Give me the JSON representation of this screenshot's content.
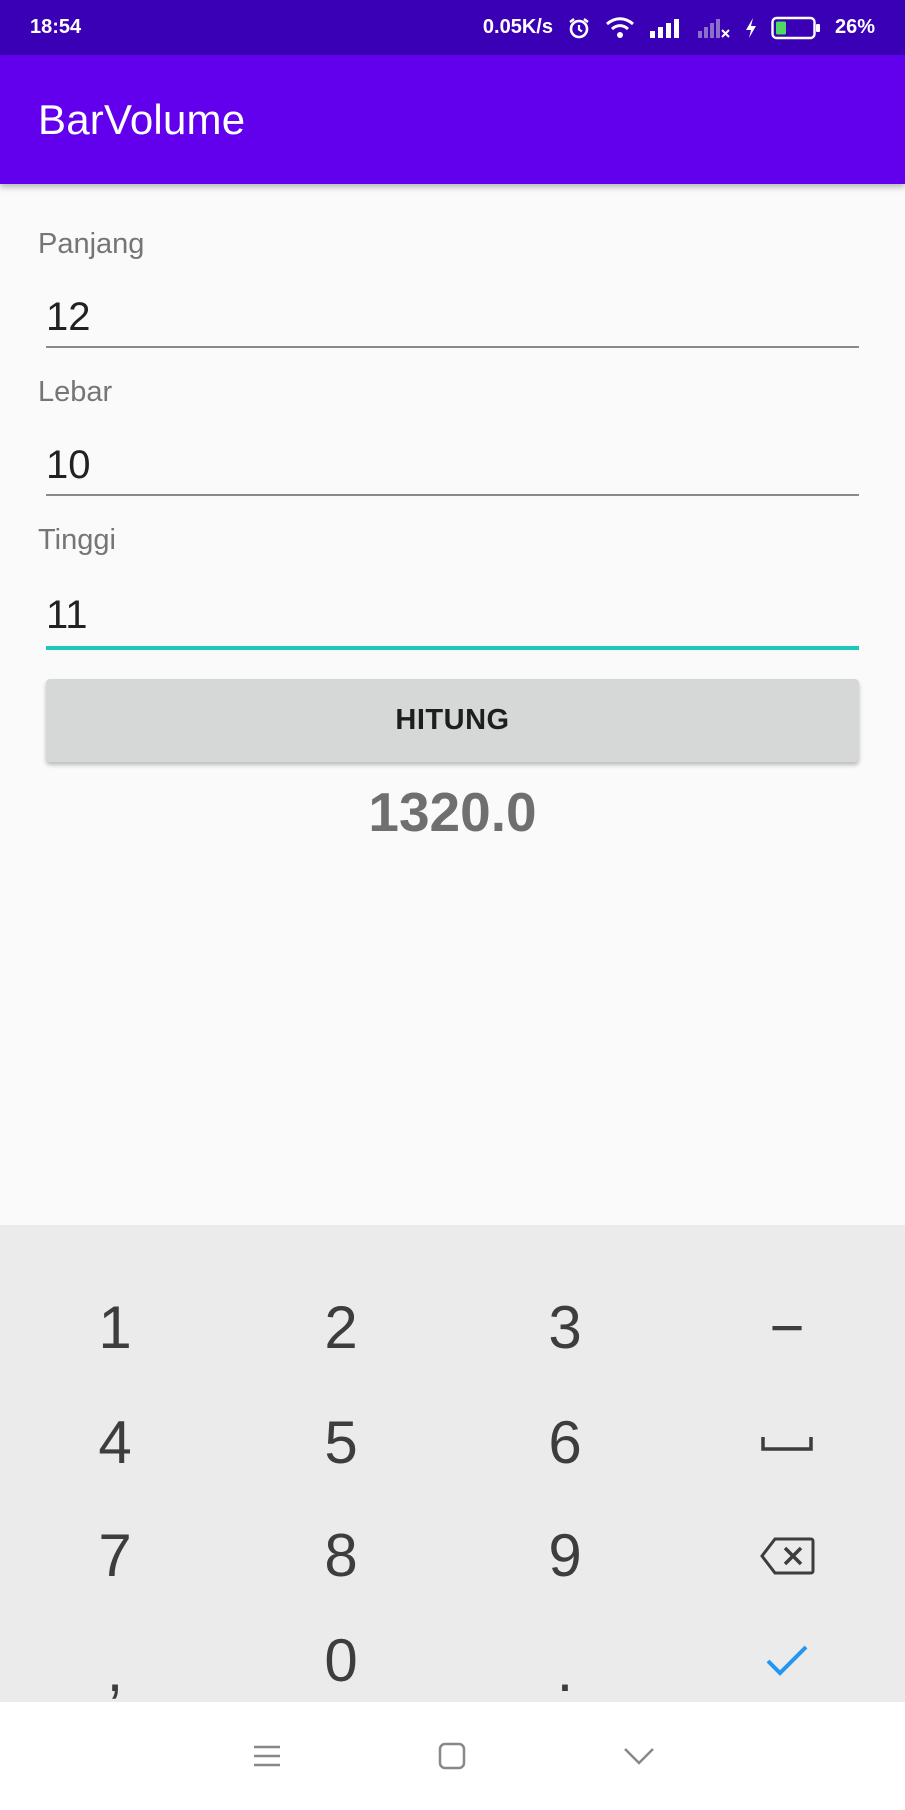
{
  "status_bar": {
    "time": "18:54",
    "network_speed": "0.05K/s",
    "battery_percent": "26%",
    "icons": [
      "alarm-icon",
      "wifi-icon",
      "signal-icon",
      "signal-no-service-icon",
      "charging-icon",
      "battery-icon"
    ]
  },
  "app_bar": {
    "title": "BarVolume",
    "color": "#6200ee"
  },
  "form": {
    "panjang_label": "Panjang",
    "panjang_value": "12",
    "lebar_label": "Lebar",
    "lebar_value": "10",
    "tinggi_label": "Tinggi",
    "tinggi_value": "11",
    "focused_field": "tinggi",
    "accent_color": "#1ec8b8"
  },
  "button": {
    "label": "HITUNG"
  },
  "result": {
    "value": "1320.0"
  },
  "keyboard": {
    "keys": [
      "1",
      "2",
      "3",
      "−",
      "4",
      "5",
      "6",
      "space-icon",
      "7",
      "8",
      "9",
      "backspace-icon",
      ",",
      "0",
      ".",
      "check-icon"
    ],
    "k1": "1",
    "k2": "2",
    "k3": "3",
    "minus": "−",
    "k4": "4",
    "k5": "5",
    "k6": "6",
    "k7": "7",
    "k8": "8",
    "k9": "9",
    "comma": ",",
    "k0": "0",
    "dot": "."
  },
  "nav_bar": {
    "icons": [
      "menu-icon",
      "home-icon",
      "back-icon"
    ]
  }
}
